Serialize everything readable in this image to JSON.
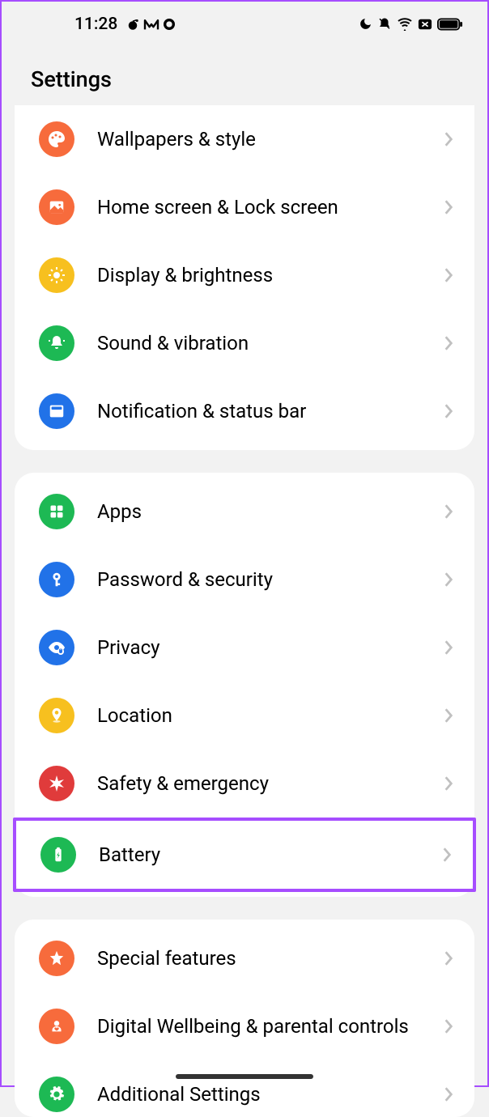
{
  "status": {
    "time": "11:28"
  },
  "header": {
    "title": "Settings"
  },
  "section1": {
    "items": [
      {
        "label": "Wallpapers & style",
        "icon": "palette",
        "color": "#f76b3c"
      },
      {
        "label": "Home screen & Lock screen",
        "icon": "image",
        "color": "#f76b3c"
      },
      {
        "label": "Display & brightness",
        "icon": "sun",
        "color": "#f7c01f"
      },
      {
        "label": "Sound & vibration",
        "icon": "bell",
        "color": "#1db954"
      },
      {
        "label": "Notification & status bar",
        "icon": "notification",
        "color": "#2172e8"
      }
    ]
  },
  "section2": {
    "items": [
      {
        "label": "Apps",
        "icon": "grid",
        "color": "#1db954"
      },
      {
        "label": "Password & security",
        "icon": "key",
        "color": "#2172e8"
      },
      {
        "label": "Privacy",
        "icon": "eye",
        "color": "#2172e8"
      },
      {
        "label": "Location",
        "icon": "pin",
        "color": "#f7c01f"
      },
      {
        "label": "Safety & emergency",
        "icon": "emergency",
        "color": "#e03b3b"
      },
      {
        "label": "Battery",
        "icon": "battery",
        "color": "#1db954",
        "highlight": true
      }
    ]
  },
  "section3": {
    "items": [
      {
        "label": "Special features",
        "icon": "star",
        "color": "#f76b3c"
      },
      {
        "label": "Digital Wellbeing & parental controls",
        "icon": "heart",
        "color": "#f76b3c"
      },
      {
        "label": "Additional Settings",
        "icon": "gear",
        "color": "#1db954"
      }
    ]
  }
}
